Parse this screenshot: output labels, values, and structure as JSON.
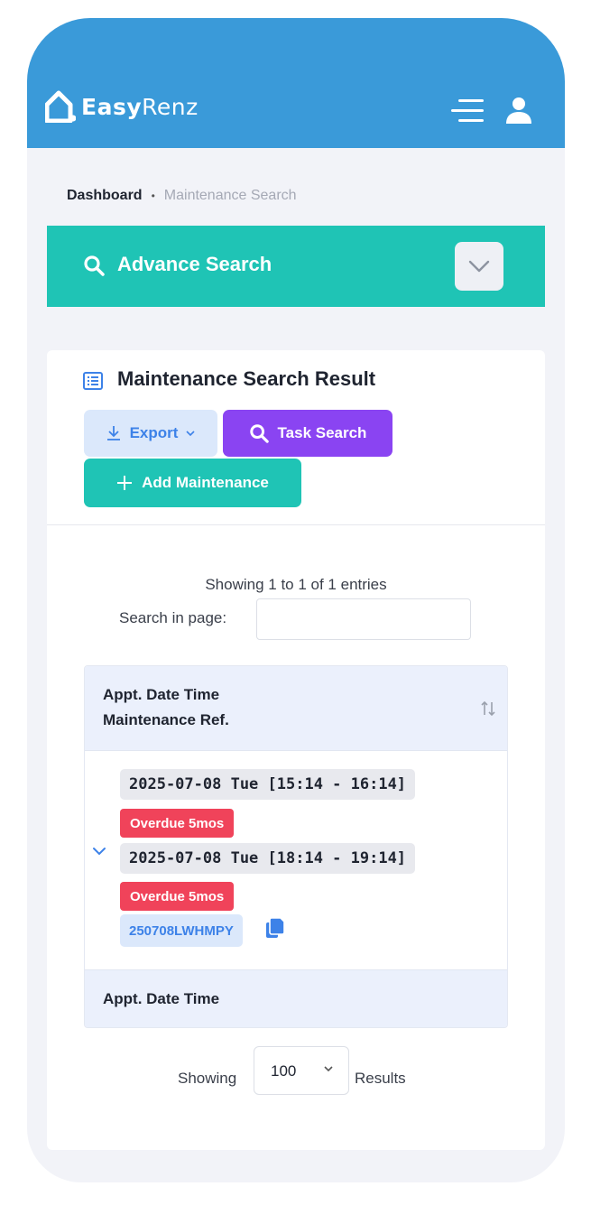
{
  "app": {
    "name_bold": "Easy",
    "name_light": "Renz"
  },
  "breadcrumb": {
    "home": "Dashboard",
    "separator": "•",
    "current": "Maintenance Search"
  },
  "advance_search": {
    "title": "Advance Search"
  },
  "results": {
    "title": "Maintenance Search Result",
    "buttons": {
      "export": "Export",
      "task_search": "Task Search",
      "add_maintenance": "Add Maintenance"
    },
    "showing_text": "Showing 1 to 1 of 1 entries",
    "search_label": "Search in page:",
    "search_value": "",
    "table": {
      "header": [
        "Appt. Date Time",
        "Maintenance Ref."
      ],
      "footer": [
        "Appt. Date Time"
      ],
      "rows": [
        {
          "appointments": [
            {
              "datetime": "2025-07-08 Tue [15:14 - 16:14]",
              "status": "Overdue 5mos"
            },
            {
              "datetime": "2025-07-08 Tue [18:14 - 19:14]",
              "status": "Overdue 5mos"
            }
          ],
          "ref": "250708LWHMPY"
        }
      ]
    },
    "pagination": {
      "showing_label": "Showing",
      "page_size": "100",
      "results_label": "Results"
    }
  },
  "colors": {
    "topbar": "#3a9ad9",
    "teal": "#1fc4b5",
    "purple": "#8a44f2",
    "overdue": "#f0435a",
    "ref_text": "#3d82e8"
  },
  "icons": [
    "home-logo-icon",
    "menu-icon",
    "user-icon",
    "search-icon",
    "chevron-down-icon",
    "list-icon",
    "download-icon",
    "plus-icon",
    "sort-icon",
    "copy-icon"
  ]
}
